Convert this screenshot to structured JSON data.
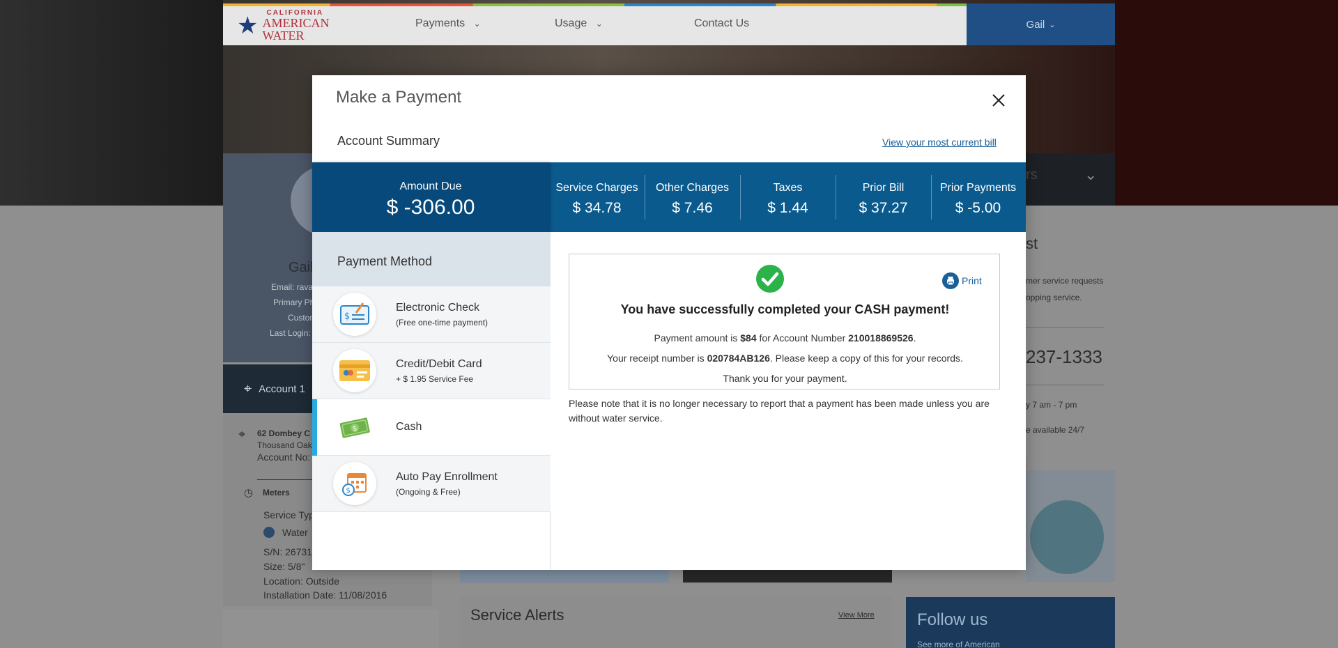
{
  "header": {
    "logo_top": "CALIFORNIA",
    "logo_bottom": "AMERICAN WATER",
    "nav": [
      {
        "label": "Payments"
      },
      {
        "label": "Usage"
      },
      {
        "label": "Contact Us"
      }
    ],
    "user_label": "Gail"
  },
  "background": {
    "profile_name": "Gail",
    "profile_lines": [
      "Email: rava",
      "Primary Ph",
      "Custom",
      "Last Login:"
    ],
    "account_label": "Account 1",
    "address_line": "62 Dombey C",
    "address_city": "Thousand Oak",
    "account_no": "Account No:",
    "meters_label": "Meters",
    "service_type": "Service Typ",
    "water_label": "Water",
    "serial": "S/N: 26731",
    "size": "Size: 5/8\"",
    "location": "Location: Outside",
    "install_date": "Installation Date: 11/08/2016",
    "contact_phone": "237-1333",
    "contact_lines": [
      "mer service requests",
      "opping service.",
      "y 7 am - 7 pm",
      "e available 24/7"
    ],
    "contact_heading": "st",
    "dark_panel_text": "rs",
    "alerts_title": "Service Alerts",
    "alerts_link": "View More",
    "follow_title": "Follow us",
    "follow_sub": "See more of American"
  },
  "modal": {
    "title": "Make a Payment",
    "summary_label": "Account Summary",
    "bill_link": "View your most current bill",
    "amount_due": {
      "label": "Amount Due",
      "value": "$ -306.00"
    },
    "charges": [
      {
        "label": "Service Charges",
        "value": "$ 34.78"
      },
      {
        "label": "Other Charges",
        "value": "$ 7.46"
      },
      {
        "label": "Taxes",
        "value": "$ 1.44"
      },
      {
        "label": "Prior Bill",
        "value": "$ 37.27"
      },
      {
        "label": "Prior Payments",
        "value": "$ -5.00"
      }
    ],
    "payment_method_label": "Payment Method",
    "methods": [
      {
        "name": "Electronic Check",
        "sub": "(Free one-time payment)",
        "icon": "check-icon"
      },
      {
        "name": "Credit/Debit Card",
        "sub": "+ $ 1.95 Service Fee",
        "icon": "credit-card-icon"
      },
      {
        "name": "Cash",
        "sub": "",
        "icon": "cash-icon",
        "selected": true
      },
      {
        "name": "Auto Pay Enrollment",
        "sub": "(Ongoing & Free)",
        "icon": "calendar-icon"
      }
    ],
    "confirmation": {
      "print_label": "Print",
      "title": "You have successfully completed your CASH payment!",
      "line1_prefix": "Payment amount is ",
      "amount": "$84",
      "line1_mid": " for Account Number ",
      "account_number": "210018869526",
      "line1_suffix": ".",
      "line2_prefix": "Your receipt number is ",
      "receipt_number": "020784AB126",
      "line2_suffix": ". Please keep a copy of this for your records.",
      "line3": "Thank you for your payment."
    },
    "note": "Please note that it is no longer necessary to report that a payment has been made unless you are without water service."
  },
  "colors": {
    "primary_blue": "#0b5a8e",
    "amount_due_bg": "#07497a",
    "selected_accent": "#2aa8e0",
    "success_green": "#2bb34a",
    "link_blue": "#1a5f96"
  }
}
